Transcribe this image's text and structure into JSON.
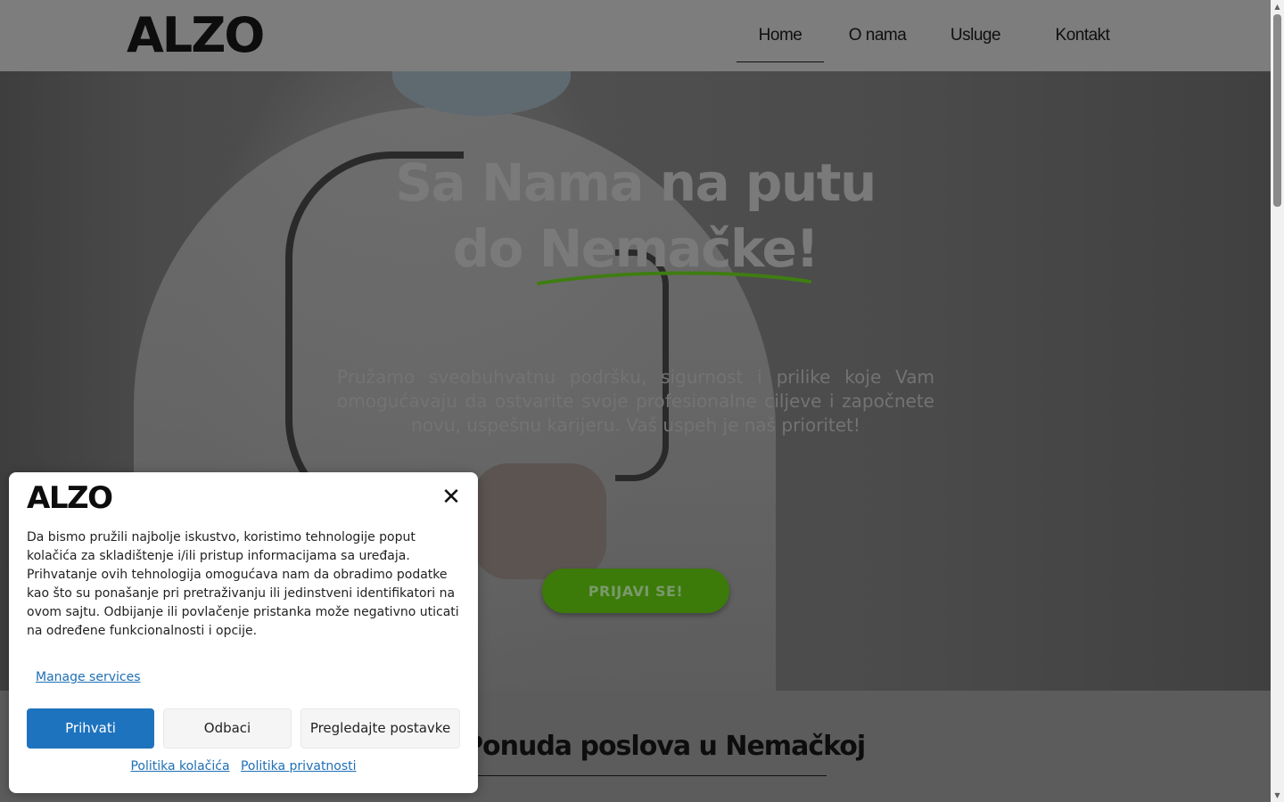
{
  "header": {
    "logo": "ALZO",
    "nav": [
      {
        "label": "Home",
        "active": true
      },
      {
        "label": "O nama",
        "active": false
      },
      {
        "label": "Usluge",
        "active": false
      },
      {
        "label": "Kontakt",
        "active": false
      }
    ]
  },
  "hero": {
    "title_line1": "Sa Nama na putu",
    "title_line2": "do Nemačke!",
    "description": "Pružamo sveobuhvatnu podršku, sigurnost i prilike koje Vam omogućavaju da ostvarite svoje profesionalne ciljeve i započnete novu, uspešnu karijeru. Vaš uspeh je naš prioritet!",
    "cta_label": "PRIJAVI SE!",
    "accent_color": "#4caf16"
  },
  "section": {
    "title": "Ponuda poslova u Nemačkoj"
  },
  "cookie_dialog": {
    "logo": "ALZO",
    "close_icon": "close-icon",
    "text": "Da bismo pružili najbolje iskustvo, koristimo tehnologije poput kolačića za skladištenje i/ili pristup informacijama sa uređaja. Prihvatanje ovih tehnologija omogućava nam da obradimo podatke kao što su ponašanje pri pretraživanju ili jedinstveni identifikatori na ovom sajtu. Odbijanje ili povlačenje pristanka može negativno uticati na određene funkcionalnosti i opcije.",
    "manage_label": "Manage services",
    "accept_label": "Prihvati",
    "deny_label": "Odbaci",
    "preferences_label": "Pregledajte postavke",
    "cookie_policy_label": "Politika kolačića",
    "privacy_policy_label": "Politika privatnosti",
    "accent_color": "#1e73be"
  }
}
